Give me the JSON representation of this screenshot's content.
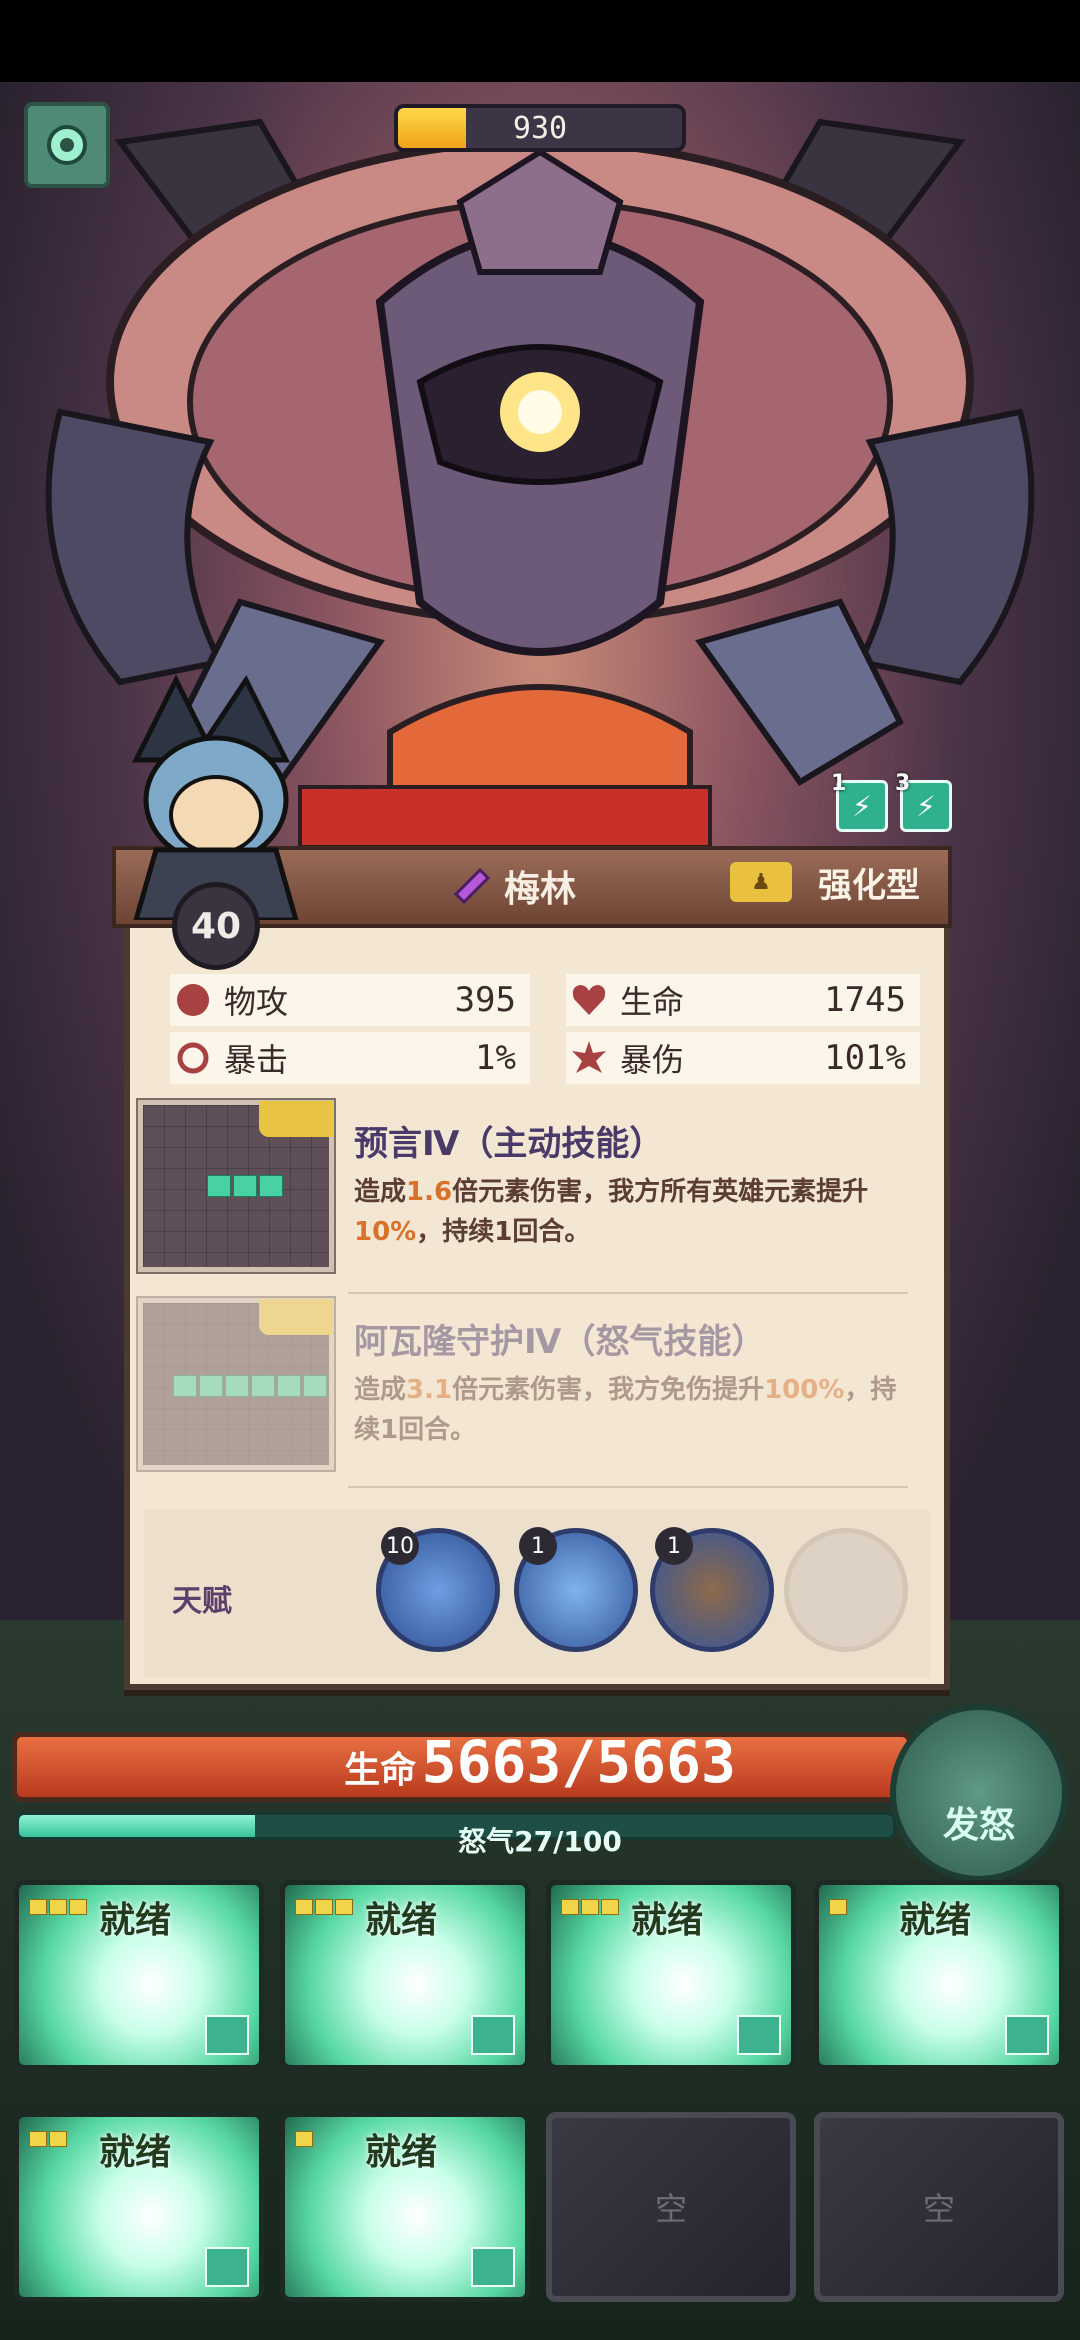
{
  "boss": {
    "hp_value": "930",
    "hp_fill_fraction": 0.24
  },
  "buffs": [
    {
      "count": "1"
    },
    {
      "count": "3"
    }
  ],
  "hero": {
    "level": "40",
    "name": "梅林",
    "type": "强化型",
    "stats": {
      "atk_label": "物攻",
      "atk_value": "395",
      "hp_label": "生命",
      "hp_value": "1745",
      "crit_label": "暴击",
      "crit_value": "1%",
      "critdmg_label": "暴伤",
      "critdmg_value": "101%"
    },
    "skills": [
      {
        "title": "预言Ⅳ（主动技能）",
        "desc_a": "造成",
        "desc_hl1": "1.6",
        "desc_b": "倍元素伤害，我方所有英雄元素提升",
        "desc_hl2": "10%",
        "desc_c": "，持续1回合。"
      },
      {
        "title": "阿瓦隆守护Ⅳ（怒气技能）",
        "desc_a": "造成",
        "desc_hl1": "3.1",
        "desc_b": "倍元素伤害，我方免伤提升",
        "desc_hl2": "100%",
        "desc_c": "，持续1回合。"
      }
    ],
    "talent_label": "天赋",
    "talents": [
      {
        "count": "10"
      },
      {
        "count": "1"
      },
      {
        "count": "1"
      }
    ]
  },
  "team": {
    "hp_label": "生命",
    "hp_value": "5663/5663",
    "rage_text": "怒气27/100",
    "rage_fraction": 0.27,
    "rage_button": "发怒"
  },
  "slots": [
    {
      "status": "就绪"
    },
    {
      "status": "就绪"
    },
    {
      "status": "就绪"
    },
    {
      "status": "就绪"
    },
    {
      "status": "就绪"
    },
    {
      "status": "就绪"
    },
    {
      "status": "空"
    },
    {
      "status": "空"
    }
  ],
  "colors": {
    "accent": "#49d1a4",
    "highlight": "#d8712a",
    "card_bg": "#f3e6d2"
  }
}
